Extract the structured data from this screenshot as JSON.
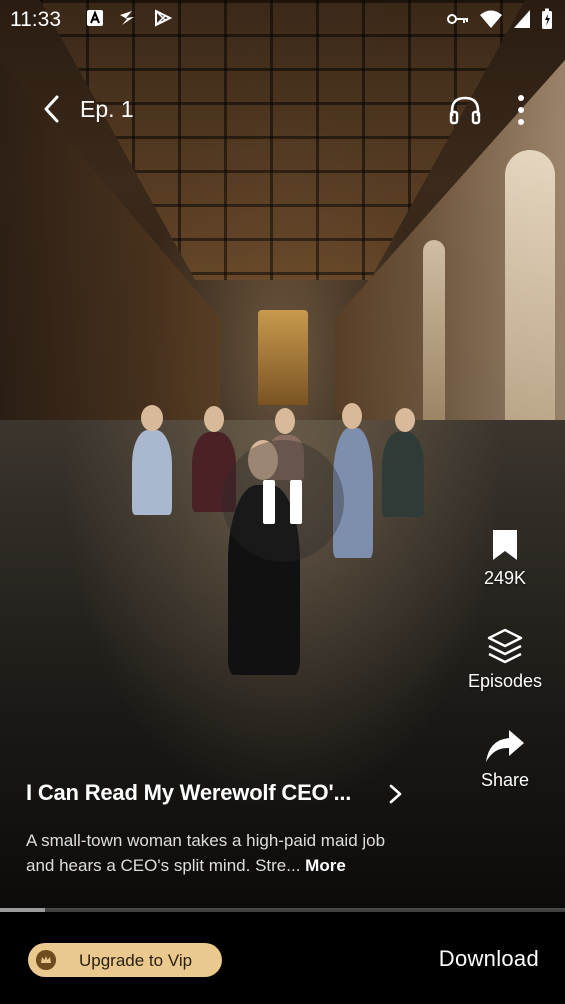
{
  "status_bar": {
    "time": "11:33",
    "left_icons": [
      "a-store-icon",
      "bolt-icon",
      "play-store-icon"
    ],
    "right_icons": [
      "key-icon",
      "wifi-icon",
      "signal-icon",
      "battery-icon"
    ]
  },
  "header": {
    "episode_title": "Ep. 1"
  },
  "sidebar": {
    "save_count": "249K",
    "episodes_label": "Episodes",
    "share_label": "Share"
  },
  "info": {
    "title": "I Can Read My Werewolf CEO'...",
    "description": "A small-town woman takes a high-paid maid job and hears a CEO's split mind. Stre...",
    "more_label": "More"
  },
  "playback": {
    "state": "playing",
    "progress": 0.08
  },
  "bottom_bar": {
    "vip_label": "Upgrade to Vip",
    "download_label": "Download"
  },
  "colors": {
    "accent_vip": "#e9c98d",
    "background": "#000000"
  }
}
